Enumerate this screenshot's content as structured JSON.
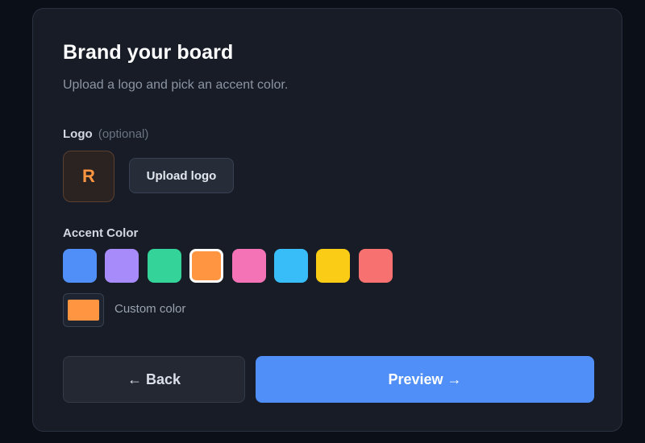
{
  "header": {
    "title": "Brand your board",
    "subtitle": "Upload a logo and pick an accent color."
  },
  "logo": {
    "label": "Logo",
    "optional_text": "(optional)",
    "preview_letter": "R",
    "preview_color": "#ff9540",
    "upload_button_label": "Upload logo"
  },
  "accent": {
    "label": "Accent Color",
    "selected_index": 3,
    "swatches": [
      {
        "color": "#4f8ff7"
      },
      {
        "color": "#a78bfa"
      },
      {
        "color": "#34d399"
      },
      {
        "color": "#ff9540"
      },
      {
        "color": "#f472b6"
      },
      {
        "color": "#38bdf8"
      },
      {
        "color": "#facc15"
      },
      {
        "color": "#f87171"
      }
    ],
    "custom": {
      "label": "Custom color",
      "value": "#ff9540"
    }
  },
  "actions": {
    "back_label": "← Back",
    "preview_label": "Preview →",
    "primary_color": "#4f8ff7"
  }
}
